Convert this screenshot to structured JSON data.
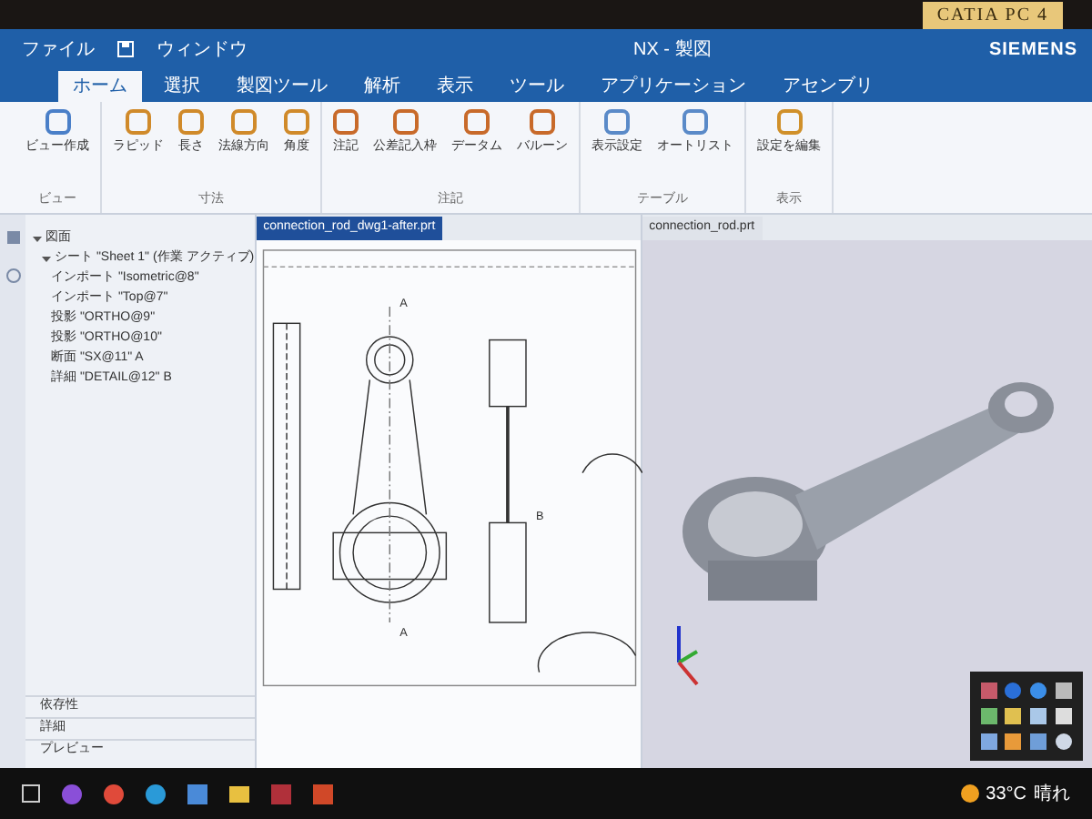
{
  "bezel": {
    "sticker": "CATIA PC 4"
  },
  "title_bar": {
    "file_menu": "ファイル",
    "window_menu": "ウィンドウ",
    "title": "NX - 製図",
    "brand": "SIEMENS"
  },
  "ribbon_tabs": [
    {
      "label": "ホーム",
      "selected": true
    },
    {
      "label": "選択",
      "selected": false
    },
    {
      "label": "製図ツール",
      "selected": false
    },
    {
      "label": "解析",
      "selected": false
    },
    {
      "label": "表示",
      "selected": false
    },
    {
      "label": "ツール",
      "selected": false
    },
    {
      "label": "アプリケーション",
      "selected": false
    },
    {
      "label": "アセンブリ",
      "selected": false
    }
  ],
  "ribbon_groups": [
    {
      "label": "ビュー",
      "buttons": [
        "ビュー作成"
      ]
    },
    {
      "label": "寸法",
      "buttons": [
        "ラピッド",
        "長さ",
        "法線方向",
        "角度"
      ]
    },
    {
      "label": "注記",
      "buttons": [
        "注記",
        "公差記入枠",
        "データム",
        "バルーン"
      ]
    },
    {
      "label": "テーブル",
      "buttons": [
        "表示設定",
        "オートリスト"
      ]
    },
    {
      "label": "表示",
      "buttons": [
        "設定を編集"
      ]
    }
  ],
  "navigator": {
    "tree": [
      {
        "label": "図面",
        "expanded": true,
        "children": [
          {
            "label": "シート \"Sheet 1\" (作業 アクティブ)",
            "expanded": true,
            "children": [
              {
                "label": "インポート \"Isometric@8\""
              },
              {
                "label": "インポート \"Top@7\""
              },
              {
                "label": "投影 \"ORTHO@9\""
              },
              {
                "label": "投影 \"ORTHO@10\""
              },
              {
                "label": "断面 \"SX@11\" A"
              },
              {
                "label": "詳細 \"DETAIL@12\" B"
              }
            ]
          }
        ]
      }
    ],
    "sections": [
      {
        "label": "依存性",
        "expanded": false
      },
      {
        "label": "詳細",
        "expanded": false
      },
      {
        "label": "プレビュー",
        "expanded": false
      }
    ]
  },
  "drawing": {
    "tab": {
      "label": "connection_rod_dwg1-after.prt",
      "selected": true
    },
    "section_labels": [
      "A",
      "A"
    ],
    "detail_label": "B"
  },
  "model": {
    "tab": {
      "label": "connection_rod.prt",
      "selected": false
    }
  },
  "taskbar": {
    "temperature": "33°C",
    "weather": "晴れ"
  }
}
